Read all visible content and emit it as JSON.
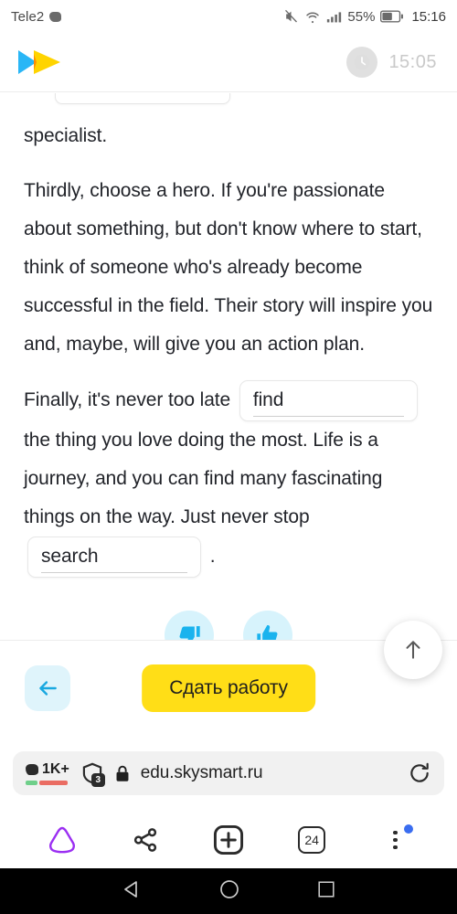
{
  "status_bar": {
    "carrier": "Tele2",
    "message_icon": "message-bubble-icon",
    "mute_icon": "mute-icon",
    "wifi_icon": "wifi-icon",
    "signal_icon": "cellular-signal-icon",
    "battery_percent": "55%",
    "battery_icon": "battery-icon",
    "clock": "15:16"
  },
  "app_header": {
    "logo_icon": "skysmart-logo-icon",
    "logo_colors": {
      "blue": "#29b6f6",
      "yellow": "#ffd400",
      "orange": "#ff9800"
    },
    "timer_icon": "clock-icon",
    "timer_value": "15:05"
  },
  "lesson": {
    "paragraphs": [
      {
        "id": "p-specialist",
        "text": "specialist."
      },
      {
        "id": "p-thirdly",
        "text": "Thirdly, choose a hero. If you're passionate about something, but don't know where to start, think of someone who's already become successful in the field. Their story will inspire you and, maybe, will give you an action plan."
      }
    ],
    "final_paragraph": {
      "lead": "Finally, it's never too late",
      "blank_1": {
        "value": "find",
        "placeholder": ""
      },
      "middle": "the thing you love doing the most. Life is a journey, and you can find many fascinating things on the way. Just never stop",
      "blank_2": {
        "value": "search",
        "placeholder": ""
      },
      "trailing": "."
    },
    "reactions": [
      {
        "id": "thumbs-down",
        "icon": "thumbs-down-icon"
      },
      {
        "id": "thumbs-up",
        "icon": "thumbs-up-icon"
      }
    ]
  },
  "action_bar": {
    "back_icon": "arrow-left-icon",
    "submit_label": "Сдать работу",
    "submit_color": "#ffde17",
    "scroll_top_icon": "arrow-up-icon"
  },
  "browser": {
    "url_bar": {
      "comment_count": "1K+",
      "comment_icon": "comment-bubble-icon",
      "rating_colors": {
        "positive": "#6fcf8a",
        "negative": "#ea6d63"
      },
      "shield_icon": "shield-icon",
      "shield_count": "3",
      "lock_icon": "lock-icon",
      "url": "edu.skysmart.ru",
      "reload_icon": "reload-icon"
    },
    "nav": [
      {
        "id": "alice",
        "icon": "alice-triangle-icon",
        "label": "",
        "color": "#9b2ff2"
      },
      {
        "id": "share",
        "icon": "share-icon",
        "label": ""
      },
      {
        "id": "new-tab",
        "icon": "plus-square-icon",
        "label": ""
      },
      {
        "id": "tabs",
        "icon": "tab-count-icon",
        "label": "24"
      },
      {
        "id": "menu",
        "icon": "more-vertical-icon",
        "label": "",
        "badge": "notification-dot"
      }
    ]
  },
  "android_nav": {
    "back_icon": "triangle-back-icon",
    "home_icon": "circle-home-icon",
    "recents_icon": "square-recents-icon"
  }
}
